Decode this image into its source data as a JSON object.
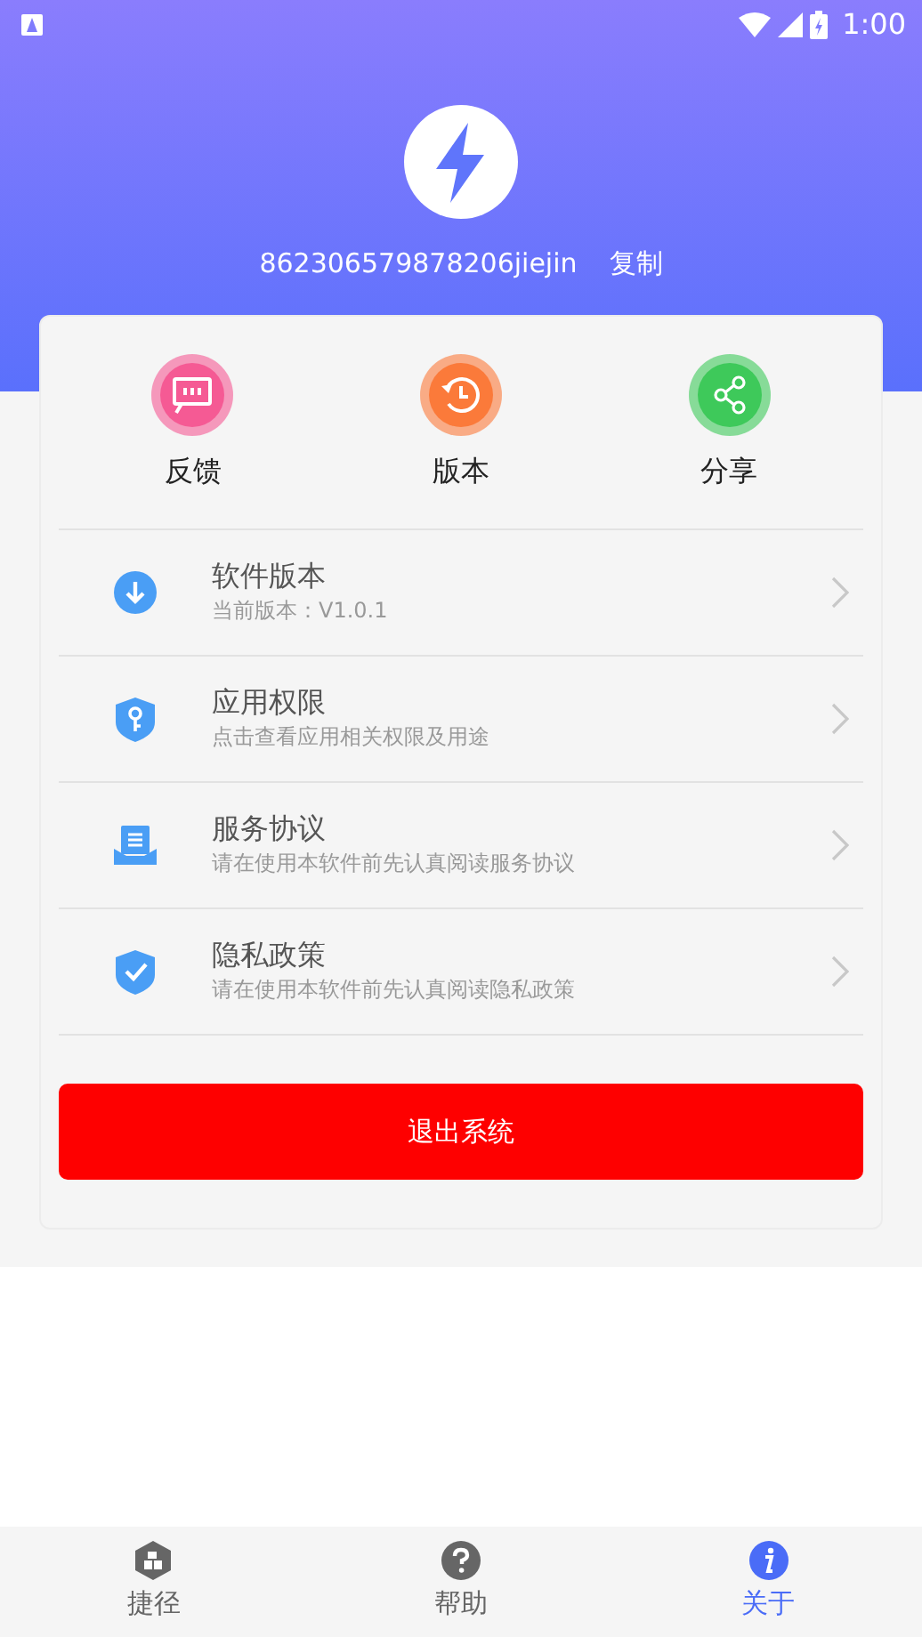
{
  "status_bar": {
    "time": "1:00"
  },
  "header": {
    "account_id": "862306579878206jiejin",
    "copy_label": "复制"
  },
  "quick_actions": [
    {
      "label": "反馈",
      "kind": "feedback",
      "color": "#f55a94"
    },
    {
      "label": "版本",
      "kind": "version",
      "color": "#fb7a3a"
    },
    {
      "label": "分享",
      "kind": "share",
      "color": "#3ec95a"
    }
  ],
  "menu": [
    {
      "title": "软件版本",
      "subtitle": "当前版本：V1.0.1",
      "kind": "download"
    },
    {
      "title": "应用权限",
      "subtitle": "点击查看应用相关权限及用途",
      "kind": "key"
    },
    {
      "title": "服务协议",
      "subtitle": "请在使用本软件前先认真阅读服务协议",
      "kind": "document"
    },
    {
      "title": "隐私政策",
      "subtitle": "请在使用本软件前先认真阅读隐私政策",
      "kind": "shield"
    }
  ],
  "logout_button": "退出系统",
  "bottom_nav": [
    {
      "label": "捷径",
      "kind": "grid",
      "selected": false
    },
    {
      "label": "帮助",
      "kind": "help",
      "selected": false
    },
    {
      "label": "关于",
      "kind": "info",
      "selected": true
    }
  ]
}
